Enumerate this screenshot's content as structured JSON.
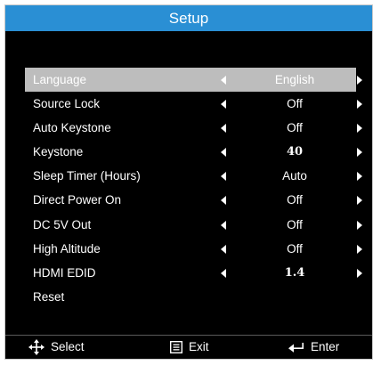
{
  "title": "Setup",
  "menu": {
    "items": [
      {
        "label": "Language",
        "value": "English",
        "arrows": true,
        "selected": true
      },
      {
        "label": "Source Lock",
        "value": "Off",
        "arrows": true
      },
      {
        "label": "Auto Keystone",
        "value": "Off",
        "arrows": true
      },
      {
        "label": "Keystone",
        "value": "40",
        "arrows": true
      },
      {
        "label": "Sleep Timer (Hours)",
        "value": "Auto",
        "arrows": true
      },
      {
        "label": "Direct Power On",
        "value": "Off",
        "arrows": true
      },
      {
        "label": "DC 5V Out",
        "value": "Off",
        "arrows": true
      },
      {
        "label": "High Altitude",
        "value": "Off",
        "arrows": true
      },
      {
        "label": "HDMI EDID",
        "value": "1.4",
        "arrows": true
      },
      {
        "label": "Reset",
        "value": "",
        "arrows": false
      }
    ]
  },
  "footer": {
    "select_label": "Select",
    "exit_label": "Exit",
    "enter_label": "Enter",
    "select_icon": "four-way-arrows-icon",
    "exit_icon": "menu-icon",
    "enter_icon": "enter-arrow-icon"
  },
  "colors": {
    "title_bar": "#2a8fd4",
    "background": "#000000",
    "selected_row": "#bdbdbd",
    "text": "#ffffff"
  }
}
